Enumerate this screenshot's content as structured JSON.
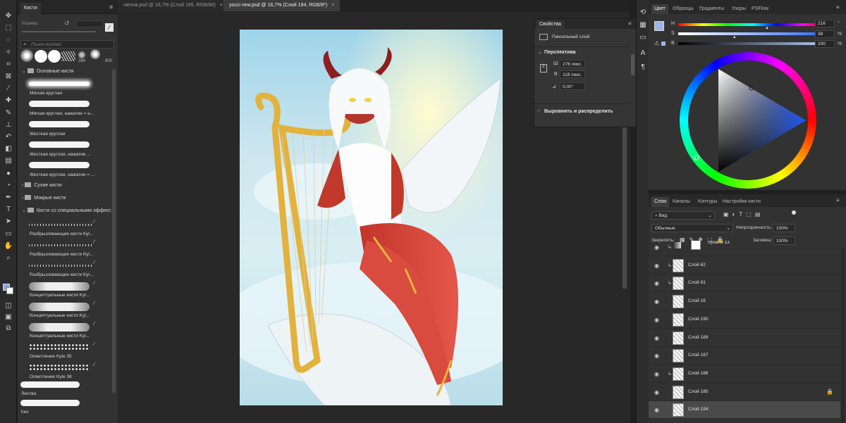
{
  "tools": [
    "move-icon",
    "marquee-icon",
    "lasso-icon",
    "magic-wand-icon",
    "crop-icon",
    "frame-icon",
    "eyedropper-icon",
    "spot-heal-icon",
    "brush-icon",
    "stamp-icon",
    "history-brush-icon",
    "eraser-icon",
    "gradient-icon",
    "blur-icon",
    "dodge-icon",
    "pen-icon",
    "type-icon",
    "path-select-icon",
    "shape-icon",
    "hand-icon",
    "zoom-icon"
  ],
  "brushes_panel": {
    "tab": "Кисти",
    "size_label": "Размер:",
    "search_placeholder": "Поиск кистей",
    "preset_numbers": [
      "284",
      "800"
    ],
    "groups": {
      "basic": "Основные кисти",
      "dry": "Сухие кисти",
      "wet": "Мокрые кисти",
      "special": "Кисти со специальными эффект..."
    },
    "basic_items": [
      {
        "label": "Мягкая круглая",
        "style": "soft"
      },
      {
        "label": "Мягкая круглая, нажатие = н...",
        "style": "hard"
      },
      {
        "label": "Жесткая круглая",
        "style": "hard"
      },
      {
        "label": "Жесткая круглая, нажатие ...",
        "style": "hard"
      },
      {
        "label": "Жесткая круглая, нажатие = ...",
        "style": "hard"
      }
    ],
    "special_items": [
      {
        "label": "Разбрызгивающие кисти Kyl...",
        "style": "spatter"
      },
      {
        "label": "Разбрызгивающие кисти Kyl...",
        "style": "spatter"
      },
      {
        "label": "Разбрызгивающие кисти Kyl...",
        "style": "spatter"
      },
      {
        "label": "Концептуальные кисти Kyl...",
        "style": "rough"
      },
      {
        "label": "Концептуальные кисти Kyl...",
        "style": "rough"
      },
      {
        "label": "Концептуальные кисти Kyl...",
        "style": "rough"
      },
      {
        "label": "Осветление Kyle 35",
        "style": "dots"
      },
      {
        "label": "Осветление Kyle 38",
        "style": "dots"
      }
    ],
    "bottom_items": [
      {
        "label": "Листва",
        "style": "hard"
      },
      {
        "label": "hex",
        "style": "hard"
      }
    ]
  },
  "doc_tabs": [
    {
      "label": "vienna.psd @ 16,7% (Слой 185, RGB/8#)",
      "active": false
    },
    {
      "label": "yocci new.psd @ 16,7% (Слой 194, RGB/8*)",
      "active": true
    }
  ],
  "properties": {
    "tab": "Свойства",
    "layer_type": "Пиксельный слой",
    "section_perspective": "Перспектива",
    "w_label": "Ш",
    "w_value": "276 пикс.",
    "h_label": "В",
    "h_value": "118 пикс.",
    "angle_value": "0,00°",
    "section_align": "Выровнять и распределить"
  },
  "color_panel": {
    "tabs": [
      "Цвет",
      "Образцы",
      "Градиенты",
      "Узоры",
      "PSFlow"
    ],
    "h": {
      "letter": "H",
      "value": "216",
      "unit": "°",
      "level": 0.6
    },
    "s": {
      "letter": "S",
      "value": "38",
      "unit": "%",
      "level": 0.38
    },
    "b": {
      "letter": "B",
      "value": "100",
      "unit": "%",
      "level": 1.0
    },
    "fg_color": "#9db4e6"
  },
  "layers_panel": {
    "tabs": [
      "Слои",
      "Каналы",
      "Контуры",
      "Настройки кисти"
    ],
    "filter_label": "Вид",
    "blend_mode": "Обычные",
    "opacity_label": "Непрозрачность:",
    "opacity_value": "100%",
    "lock_label": "Закрепить:",
    "fill_label": "Заливка:",
    "fill_value": "100%",
    "layers": [
      {
        "name": "Уровни 13",
        "clip": true,
        "adjust": true,
        "active": false,
        "locked": false
      },
      {
        "name": "Слой 62",
        "clip": true,
        "active": false,
        "locked": false
      },
      {
        "name": "Слой 61",
        "clip": true,
        "active": false,
        "locked": false
      },
      {
        "name": "Слой 16",
        "clip": false,
        "active": false,
        "locked": false
      },
      {
        "name": "Слой 190",
        "clip": false,
        "active": false,
        "locked": false
      },
      {
        "name": "Слой 189",
        "clip": false,
        "active": false,
        "locked": false
      },
      {
        "name": "Слой 187",
        "clip": false,
        "active": false,
        "locked": false
      },
      {
        "name": "Слой 186",
        "clip": true,
        "active": false,
        "locked": false
      },
      {
        "name": "Слой 185",
        "clip": false,
        "active": false,
        "locked": true
      },
      {
        "name": "Слой 194",
        "clip": false,
        "active": true,
        "locked": false
      }
    ]
  }
}
